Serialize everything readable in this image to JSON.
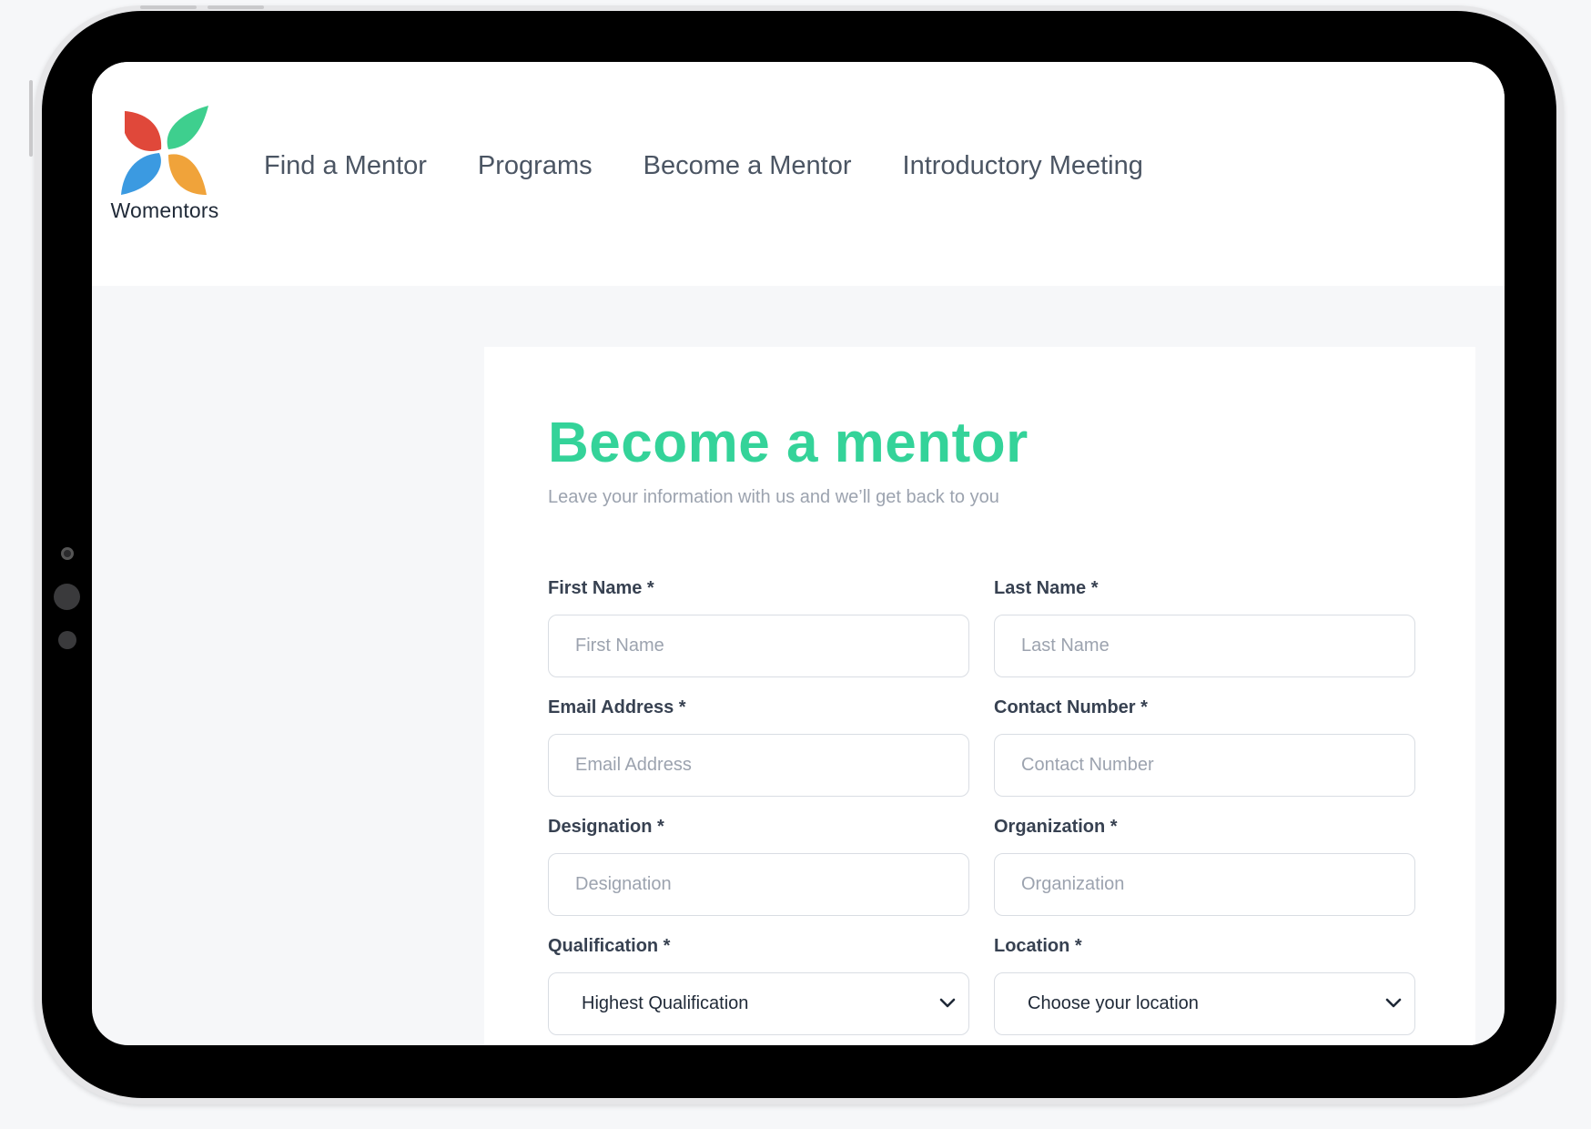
{
  "brand": {
    "name": "Womentors"
  },
  "nav": {
    "items": [
      {
        "label": "Find a Mentor"
      },
      {
        "label": "Programs"
      },
      {
        "label": "Become a Mentor"
      },
      {
        "label": "Introductory Meeting"
      }
    ]
  },
  "form": {
    "title": "Become a mentor",
    "subtitle": "Leave your information with us and we’ll get back to you",
    "fields": {
      "first_name": {
        "label": "First Name *",
        "placeholder": "First Name"
      },
      "last_name": {
        "label": "Last Name *",
        "placeholder": "Last Name"
      },
      "email": {
        "label": "Email Address *",
        "placeholder": "Email Address"
      },
      "contact": {
        "label": "Contact Number *",
        "placeholder": "Contact Number"
      },
      "designation": {
        "label": "Designation *",
        "placeholder": "Designation"
      },
      "organization": {
        "label": "Organization *",
        "placeholder": "Organization"
      },
      "qualification": {
        "label": "Qualification *",
        "selected": "Highest Qualification"
      },
      "location": {
        "label": "Location *",
        "selected": "Choose your location"
      }
    }
  },
  "colors": {
    "accent": "#34d399",
    "logo_red": "#e0483a",
    "logo_green": "#3ecf8e",
    "logo_blue": "#3b9ae1",
    "logo_orange": "#f0a33a"
  }
}
